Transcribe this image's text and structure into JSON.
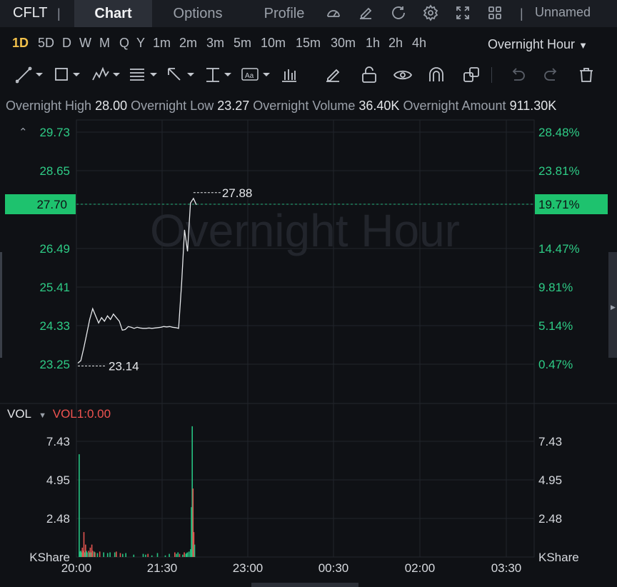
{
  "header": {
    "symbol": "CFLT",
    "tabs": [
      "Chart",
      "Options",
      "Profile"
    ],
    "active_tab": "Chart",
    "tool_icons": [
      "gauge-icon",
      "edit-icon",
      "refresh-icon",
      "settings-icon",
      "fullscreen-icon",
      "layout-grid-icon"
    ],
    "layout_name": "Unnamed"
  },
  "periods": {
    "items": [
      "1D",
      "5D",
      "D",
      "W",
      "M",
      "Q",
      "Y",
      "1m",
      "2m",
      "3m",
      "5m",
      "10m",
      "15m",
      "30m",
      "1h",
      "2h",
      "4h"
    ],
    "active": "1D",
    "session": "Overnight Hour"
  },
  "drawing_tools": [
    "trendline-icon",
    "rectangle-icon",
    "pattern-icon",
    "fibonacci-icon",
    "arrow-icon",
    "measure-icon",
    "text-icon",
    "indicator-icon",
    "pencil-icon",
    "unlock-icon",
    "eye-icon",
    "magnet-icon",
    "clone-icon",
    "undo-icon",
    "redo-icon",
    "trash-icon"
  ],
  "stats": {
    "high_label": "Overnight High",
    "high": "28.00",
    "low_label": "Overnight Low",
    "low": "23.27",
    "volume_label": "Overnight Volume",
    "volume": "36.40K",
    "amount_label": "Overnight Amount",
    "amount": "911.30K"
  },
  "colors": {
    "up": "#26a69a",
    "down": "#ef5350",
    "accent": "#f2c14b",
    "price_tag": "#1ec26e"
  },
  "chart_data": [
    {
      "type": "line",
      "watermark": "Overnight Hour",
      "x_ticks": [
        "20:00",
        "21:30",
        "23:00",
        "00:30",
        "02:00",
        "03:30"
      ],
      "y_ticks_left": [
        "29.73",
        "28.65",
        "27.70",
        "26.49",
        "25.41",
        "24.33",
        "23.25"
      ],
      "y_ticks_right": [
        "28.48%",
        "23.81%",
        "19.71%",
        "14.47%",
        "9.81%",
        "5.14%",
        "0.47%"
      ],
      "ylim": [
        23.25,
        29.73
      ],
      "current_price": "27.70",
      "current_change": "19.71%",
      "high_marker": "27.88",
      "low_marker": "23.14",
      "points": [
        [
          0,
          23.28
        ],
        [
          1,
          23.35
        ],
        [
          2,
          23.7
        ],
        [
          3,
          24.1
        ],
        [
          4,
          24.5
        ],
        [
          5,
          24.8
        ],
        [
          6,
          24.6
        ],
        [
          7,
          24.4
        ],
        [
          8,
          24.55
        ],
        [
          9,
          24.45
        ],
        [
          10,
          24.6
        ],
        [
          11,
          24.5
        ],
        [
          12,
          24.65
        ],
        [
          13,
          24.55
        ],
        [
          14,
          24.45
        ],
        [
          15,
          24.2
        ],
        [
          16,
          24.22
        ],
        [
          17,
          24.3
        ],
        [
          18,
          24.28
        ],
        [
          19,
          24.25
        ],
        [
          20,
          24.28
        ],
        [
          21,
          24.26
        ],
        [
          22,
          24.25
        ],
        [
          23,
          24.25
        ],
        [
          24,
          24.26
        ],
        [
          25,
          24.25
        ],
        [
          26,
          24.26
        ],
        [
          27,
          24.27
        ],
        [
          28,
          24.28
        ],
        [
          29,
          24.3
        ],
        [
          30,
          24.29
        ],
        [
          31,
          24.3
        ],
        [
          32,
          24.28
        ],
        [
          33,
          24.27
        ],
        [
          34,
          24.25
        ],
        [
          35,
          25.5
        ],
        [
          36,
          27.0
        ],
        [
          37,
          26.4
        ],
        [
          38,
          27.75
        ],
        [
          39,
          27.88
        ],
        [
          40,
          27.7
        ]
      ]
    },
    {
      "type": "bar",
      "name": "VOL",
      "indicator": "VOL1:0.00",
      "unit": "KShare",
      "y_ticks": [
        "7.43",
        "4.95",
        "2.48"
      ],
      "ylim": [
        0,
        8.6
      ],
      "bars": [
        [
          1,
          6.6,
          "up"
        ],
        [
          2,
          0.35,
          "up"
        ],
        [
          3,
          0.4,
          "up"
        ],
        [
          4,
          0.3,
          "up"
        ],
        [
          5,
          0.6,
          "down"
        ],
        [
          6,
          0.4,
          "down"
        ],
        [
          7,
          1.6,
          "down"
        ],
        [
          8,
          0.3,
          "up"
        ],
        [
          9,
          0.8,
          "down"
        ],
        [
          10,
          0.4,
          "up"
        ],
        [
          11,
          0.3,
          "up"
        ],
        [
          13,
          0.4,
          "down"
        ],
        [
          14,
          0.3,
          "up"
        ],
        [
          15,
          0.6,
          "down"
        ],
        [
          16,
          0.3,
          "up"
        ],
        [
          17,
          0.8,
          "down"
        ],
        [
          18,
          0.4,
          "down"
        ],
        [
          20,
          0.35,
          "up"
        ],
        [
          21,
          0.3,
          "down"
        ],
        [
          24,
          0.25,
          "up"
        ],
        [
          27,
          0.35,
          "down"
        ],
        [
          32,
          0.3,
          "up"
        ],
        [
          37,
          0.25,
          "up"
        ],
        [
          40,
          0.3,
          "up"
        ],
        [
          46,
          0.3,
          "up"
        ],
        [
          48,
          0.35,
          "down"
        ],
        [
          53,
          0.25,
          "down"
        ],
        [
          56,
          0.2,
          "up"
        ],
        [
          60,
          0.25,
          "up"
        ],
        [
          70,
          0.15,
          "up"
        ],
        [
          82,
          0.2,
          "up"
        ],
        [
          85,
          0.15,
          "up"
        ],
        [
          88,
          0.2,
          "down"
        ],
        [
          93,
          0.1,
          "up"
        ],
        [
          100,
          0.25,
          "up"
        ],
        [
          110,
          0.1,
          "up"
        ],
        [
          115,
          0.2,
          "up"
        ],
        [
          122,
          0.3,
          "down"
        ],
        [
          124,
          0.2,
          "up"
        ],
        [
          126,
          0.3,
          "up"
        ],
        [
          128,
          0.2,
          "down"
        ],
        [
          132,
          0.15,
          "up"
        ],
        [
          134,
          0.3,
          "down"
        ],
        [
          136,
          0.2,
          "up"
        ],
        [
          137,
          0.25,
          "up"
        ],
        [
          138,
          0.3,
          "up"
        ],
        [
          140,
          0.35,
          "up"
        ],
        [
          142,
          0.5,
          "up"
        ],
        [
          143,
          3.2,
          "up"
        ],
        [
          144,
          8.4,
          "up"
        ],
        [
          145,
          4.4,
          "down"
        ],
        [
          146,
          1.6,
          "down"
        ],
        [
          147,
          0.8,
          "up"
        ]
      ]
    }
  ]
}
